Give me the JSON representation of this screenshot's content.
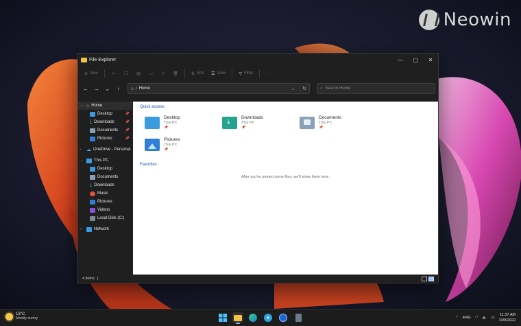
{
  "watermark": {
    "text": "Neowin"
  },
  "window": {
    "title": "File Explorer",
    "controls": {
      "minimize": "—",
      "maximize": "▢",
      "close": "✕"
    }
  },
  "toolbar": {
    "new_label": "New",
    "sort_label": "Sort",
    "view_label": "View",
    "filter_label": "Filter",
    "more_label": "···"
  },
  "nav": {
    "back": "←",
    "forward": "→",
    "recent": "⌄",
    "up": "↑",
    "address_text": "Home",
    "address_sep": "›",
    "dropdown": "⌄",
    "refresh": "↻",
    "search_placeholder": "Search Home"
  },
  "sidebar": {
    "home": "Home",
    "quick_items": [
      {
        "label": "Desktop"
      },
      {
        "label": "Downloads"
      },
      {
        "label": "Documents"
      },
      {
        "label": "Pictures"
      }
    ],
    "onedrive": "OneDrive - Personal",
    "this_pc": "This PC",
    "pc_items": [
      {
        "label": "Desktop"
      },
      {
        "label": "Documents"
      },
      {
        "label": "Downloads"
      },
      {
        "label": "Music"
      },
      {
        "label": "Pictures"
      },
      {
        "label": "Videos"
      },
      {
        "label": "Local Disk (C:)"
      }
    ],
    "network": "Network",
    "pin_glyph": "📌"
  },
  "content": {
    "quick_access_heading": "Quick access",
    "tiles": [
      {
        "name": "Desktop",
        "location": "This PC"
      },
      {
        "name": "Downloads",
        "location": "This PC"
      },
      {
        "name": "Documents",
        "location": "This PC"
      },
      {
        "name": "Pictures",
        "location": "This PC"
      }
    ],
    "favorites_heading": "Favorites",
    "favorites_empty": "After you've pinned some files, we'll show them here."
  },
  "statusbar": {
    "count": "4 items",
    "separator": "|"
  },
  "taskbar": {
    "weather_temp": "13°C",
    "weather_cond": "Mostly sunny",
    "tray_chevron": "⌃",
    "language": "ENG",
    "time": "11:37 AM",
    "date": "10/9/2022"
  },
  "colors": {
    "folder_blue": "#3a9be0",
    "folder_teal": "#25a38f",
    "doc_grey": "#8aa0b8",
    "pictures_blue": "#2f7fd6",
    "accent": "#1a4fa8"
  }
}
